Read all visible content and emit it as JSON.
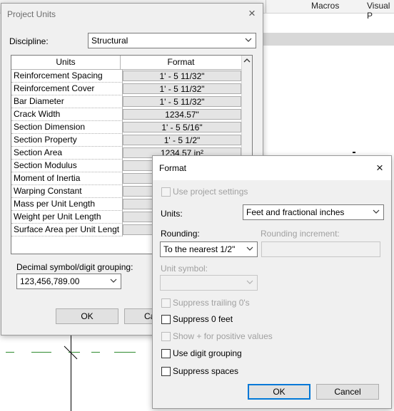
{
  "app": {
    "ribbon_tabs": [
      "Macros",
      "Visual P"
    ]
  },
  "project_units": {
    "title": "Project Units",
    "discipline_label": "Discipline:",
    "discipline_value": "Structural",
    "table": {
      "columns": [
        "Units",
        "Format"
      ],
      "rows": [
        {
          "unit": "Reinforcement Spacing",
          "format": "1' - 5 11/32\""
        },
        {
          "unit": "Reinforcement Cover",
          "format": "1' - 5 11/32\""
        },
        {
          "unit": "Bar Diameter",
          "format": "1' - 5 11/32\""
        },
        {
          "unit": "Crack Width",
          "format": "1234.57\""
        },
        {
          "unit": "Section Dimension",
          "format": "1' - 5 5/16\""
        },
        {
          "unit": "Section Property",
          "format": "1' - 5 1/2\""
        },
        {
          "unit": "Section Area",
          "format": "1234.57 in²"
        },
        {
          "unit": "Section Modulus",
          "format": ""
        },
        {
          "unit": "Moment of Inertia",
          "format": ""
        },
        {
          "unit": "Warping Constant",
          "format": ""
        },
        {
          "unit": "Mass per Unit Length",
          "format": ""
        },
        {
          "unit": "Weight per Unit Length",
          "format": ""
        },
        {
          "unit": "Surface Area per Unit Lengt",
          "format": ""
        }
      ]
    },
    "decimal_label": "Decimal symbol/digit grouping:",
    "decimal_value": "123,456,789.00",
    "ok_label": "OK",
    "cancel_label": "Ca"
  },
  "format_dialog": {
    "title": "Format",
    "use_project_settings": {
      "label": "Use project settings",
      "checked": false
    },
    "units_label": "Units:",
    "units_value": "Feet and fractional inches",
    "rounding_label": "Rounding:",
    "rounding_value": "To the nearest 1/2\"",
    "rounding_increment_label": "Rounding increment:",
    "rounding_increment_value": "",
    "unit_symbol_label": "Unit symbol:",
    "unit_symbol_value": "",
    "options": [
      {
        "label": "Suppress trailing 0's",
        "checked": false,
        "enabled": false
      },
      {
        "label": "Suppress 0 feet",
        "checked": false,
        "enabled": true
      },
      {
        "label": "Show + for positive values",
        "checked": false,
        "enabled": false
      },
      {
        "label": "Use digit grouping",
        "checked": false,
        "enabled": true
      },
      {
        "label": "Suppress spaces",
        "checked": false,
        "enabled": true
      }
    ],
    "ok_label": "OK",
    "cancel_label": "Cancel"
  },
  "colors": {
    "accent": "#0078d7",
    "drawing_line": "#2e8b2e"
  }
}
